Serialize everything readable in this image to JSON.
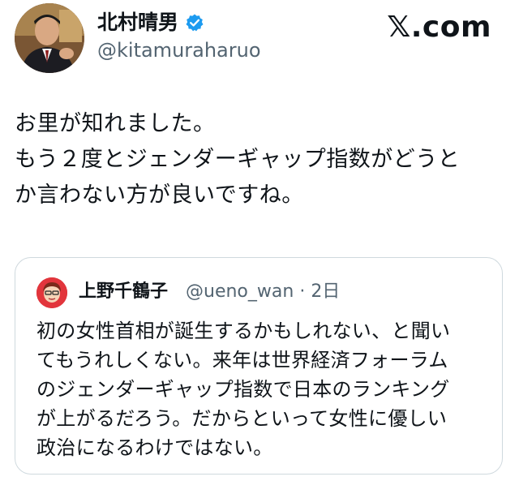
{
  "author": {
    "name": "北村晴男",
    "handle": "@kitamuraharuo",
    "verified": true
  },
  "site_logo": "𝕏.com",
  "tweet": {
    "text": "お里が知れました。\nもう２度とジェンダーギャップ指数がどうと\nか言わない方が良いですね。"
  },
  "quoted": {
    "name": "上野千鶴子",
    "handle": "@ueno_wan",
    "separator": "·",
    "time": "2日",
    "text": "初の女性首相が誕生するかもしれない、と聞い\nてもうれしくない。来年は世界経済フォーラム\nのジェンダーギャップ指数で日本のランキング\nが上がるだろう。だからといって女性に優しい\n政治になるわけではない。"
  },
  "colors": {
    "text": "#0f1419",
    "secondary": "#536471",
    "verified": "#1d9bf0",
    "border": "#cfd9de"
  }
}
